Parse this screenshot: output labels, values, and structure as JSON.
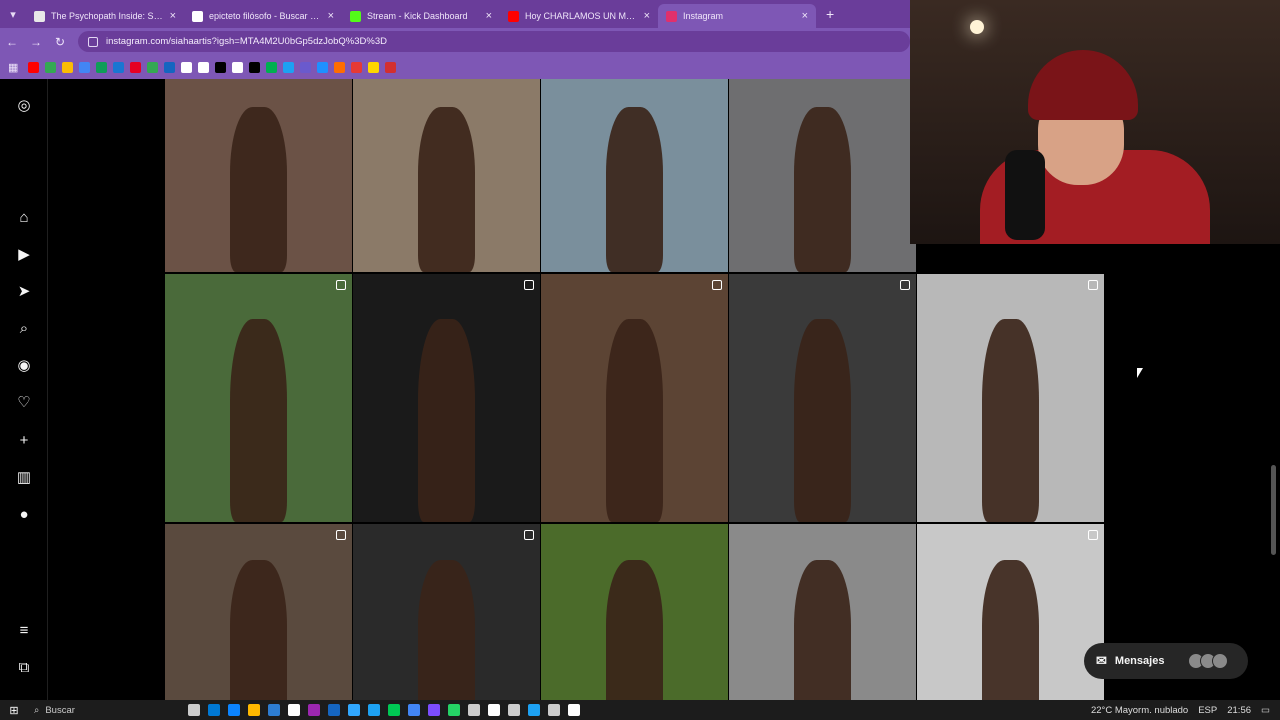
{
  "browser": {
    "tabs": [
      {
        "title": "The Psychopath Inside: Summa",
        "fav": "#e8e8e8"
      },
      {
        "title": "epicteto filósofo - Buscar con G",
        "fav": "#ffffff"
      },
      {
        "title": "Stream - Kick Dashboard",
        "fav": "#53fc18"
      },
      {
        "title": "Hoy CHARLAMOS UN MONTO",
        "fav": "#ff0000"
      },
      {
        "title": "Instagram",
        "fav": "#e1306c"
      }
    ],
    "new_tab": "+",
    "url": "instagram.com/siahaartis?igsh=MTA4M2U0bGp5dzJobQ%3D%3D",
    "bookmark_colors": [
      "#ff0000",
      "#34a853",
      "#fbbc05",
      "#4285f4",
      "#0f9d58",
      "#1976d2",
      "#e60023",
      "#34a853",
      "#1565c0",
      "#ffffff",
      "#ffffff",
      "#000000",
      "#ffffff",
      "#000000",
      "#00b050",
      "#1da1f2",
      "#6a5acd",
      "#1e90ff",
      "#ff6d00",
      "#e53935",
      "#ffd600",
      "#d32f2f"
    ]
  },
  "instagram": {
    "side_icons": [
      "instagram-logo-icon",
      "home-icon",
      "reels-icon",
      "send-icon",
      "search-icon",
      "explore-icon",
      "heart-icon",
      "create-icon",
      "dashboard-icon",
      "profile-icon",
      "menu-icon",
      "meta-icon"
    ],
    "tiles": [
      {
        "bg": "#6b5246",
        "reel": false
      },
      {
        "bg": "#8b7a68",
        "reel": false
      },
      {
        "bg": "#7a8f9c",
        "reel": false
      },
      {
        "bg": "#6e6e70",
        "reel": false
      },
      {
        "bg": "#4a6a3a",
        "reel": true
      },
      {
        "bg": "#1a1a1a",
        "reel": true
      },
      {
        "bg": "#5c4434",
        "reel": true
      },
      {
        "bg": "#3a3a3a",
        "reel": true
      },
      {
        "bg": "#b8b8b8",
        "reel": true
      },
      {
        "bg": "#5a4a3e",
        "reel": true
      },
      {
        "bg": "#2a2a2a",
        "reel": true
      },
      {
        "bg": "#4b6b2a",
        "reel": false
      },
      {
        "bg": "#8a8a8a",
        "reel": false
      },
      {
        "bg": "#c8c8c8",
        "reel": true
      }
    ],
    "messages_label": "Mensajes"
  },
  "taskbar": {
    "search": "Buscar",
    "weather": "22°C  Mayorm. nublado",
    "lang": "ESP",
    "time": "21:56",
    "app_colors": [
      "#cccccc",
      "#0078d4",
      "#0b84ff",
      "#ffb900",
      "#2d7dd2",
      "#ffffff",
      "#9c27b0",
      "#1565c0",
      "#31a8ff",
      "#1da1f2",
      "#00c853",
      "#4285f4",
      "#7c4dff",
      "#25d366",
      "#cccccc",
      "#ffffff",
      "#cccccc",
      "#1da1f2",
      "#cccccc",
      "#ffffff"
    ]
  }
}
